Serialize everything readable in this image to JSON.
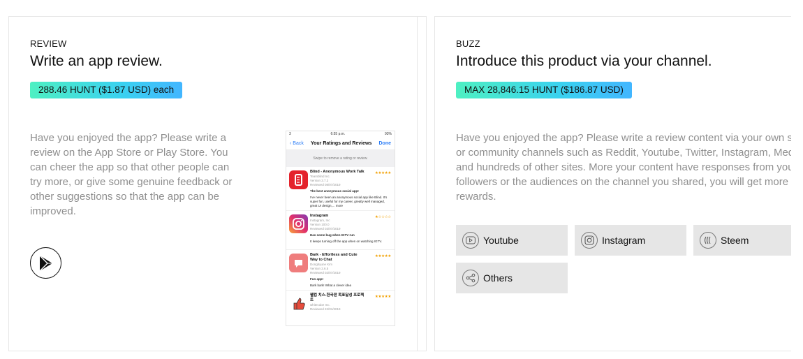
{
  "review": {
    "kicker": "REVIEW",
    "title": "Write an app review.",
    "reward": "288.46 HUNT ($1.87 USD) each",
    "description": "Have you enjoyed the app? Please write a review on the App Store or Play Store. You can cheer the app so that other people can try more, or give some genuine feedback or other suggestions so that the app can be improved.",
    "store_icon": "google-play-icon",
    "phone": {
      "status_left": "3 ",
      "status_time": "6:55 p.m.",
      "status_right": "93%",
      "back": "Back",
      "nav_title": "Your Ratings and Reviews",
      "done": "Done",
      "hint": "Swipe to remove a rating or review.",
      "items": [
        {
          "name": "Blind - Anonymous Work Talk",
          "stars": "★★★★★",
          "meta1": "Teamblind Inc.",
          "meta2": "Version 3.7.2",
          "meta3": "Reviewed 08/07/2019",
          "review_title": "The best anonymous social app!",
          "review_text": "I've never been an anonymous social app like Blind. It's super fun, useful for my career, greatly well managed, great UI design,... more",
          "icon_color": "#e4232c"
        },
        {
          "name": "Instagram",
          "stars": "★☆☆☆☆",
          "meta1": "Instagram, Inc",
          "meta2": "Version 100.0",
          "meta3": "Reviewed 03/07/2019",
          "review_title": "Has some bug when IGTV run",
          "review_text": "It keeps turning off the app when on watching IGTV.",
          "icon_color": "#d62a7c"
        },
        {
          "name": "Bark - Effortless and Cute Way to Chat",
          "stars": "★★★★★",
          "meta1": "Donghyune Kim",
          "meta2": "Version 2.6.5",
          "meta3": "Reviewed 02/07/2019",
          "review_title": "Fun app!",
          "review_text": "Bark bark! What a clever idea",
          "icon_color": "#ef7d7d"
        },
        {
          "name": "웰컴 치스-한국판 목표달성 프로젝트",
          "stars": "★★★★★",
          "meta1": "whitecube Inc.",
          "meta2": "",
          "meta3": "Reviewed 22/01/2019",
          "review_title": "",
          "review_text": "",
          "icon_color": "#ffffff"
        }
      ]
    }
  },
  "buzz": {
    "kicker": "BUZZ",
    "title": "Introduce this product via your channel.",
    "reward": "MAX 28,846.15 HUNT ($186.87 USD)",
    "description": "Have you enjoyed the app? Please write a review content via your own social or community channels such as Reddit, Youtube, Twitter, Instagram, Medium, and hundreds of other sites. More your content have responses from your followers or the audiences on the channel you shared, you will get more rewards.",
    "channels": [
      {
        "label": "Youtube",
        "icon": "youtube-icon"
      },
      {
        "label": "Instagram",
        "icon": "instagram-icon"
      },
      {
        "label": "Steem",
        "icon": "steem-icon"
      },
      {
        "label": "Others",
        "icon": "share-icon"
      }
    ]
  }
}
